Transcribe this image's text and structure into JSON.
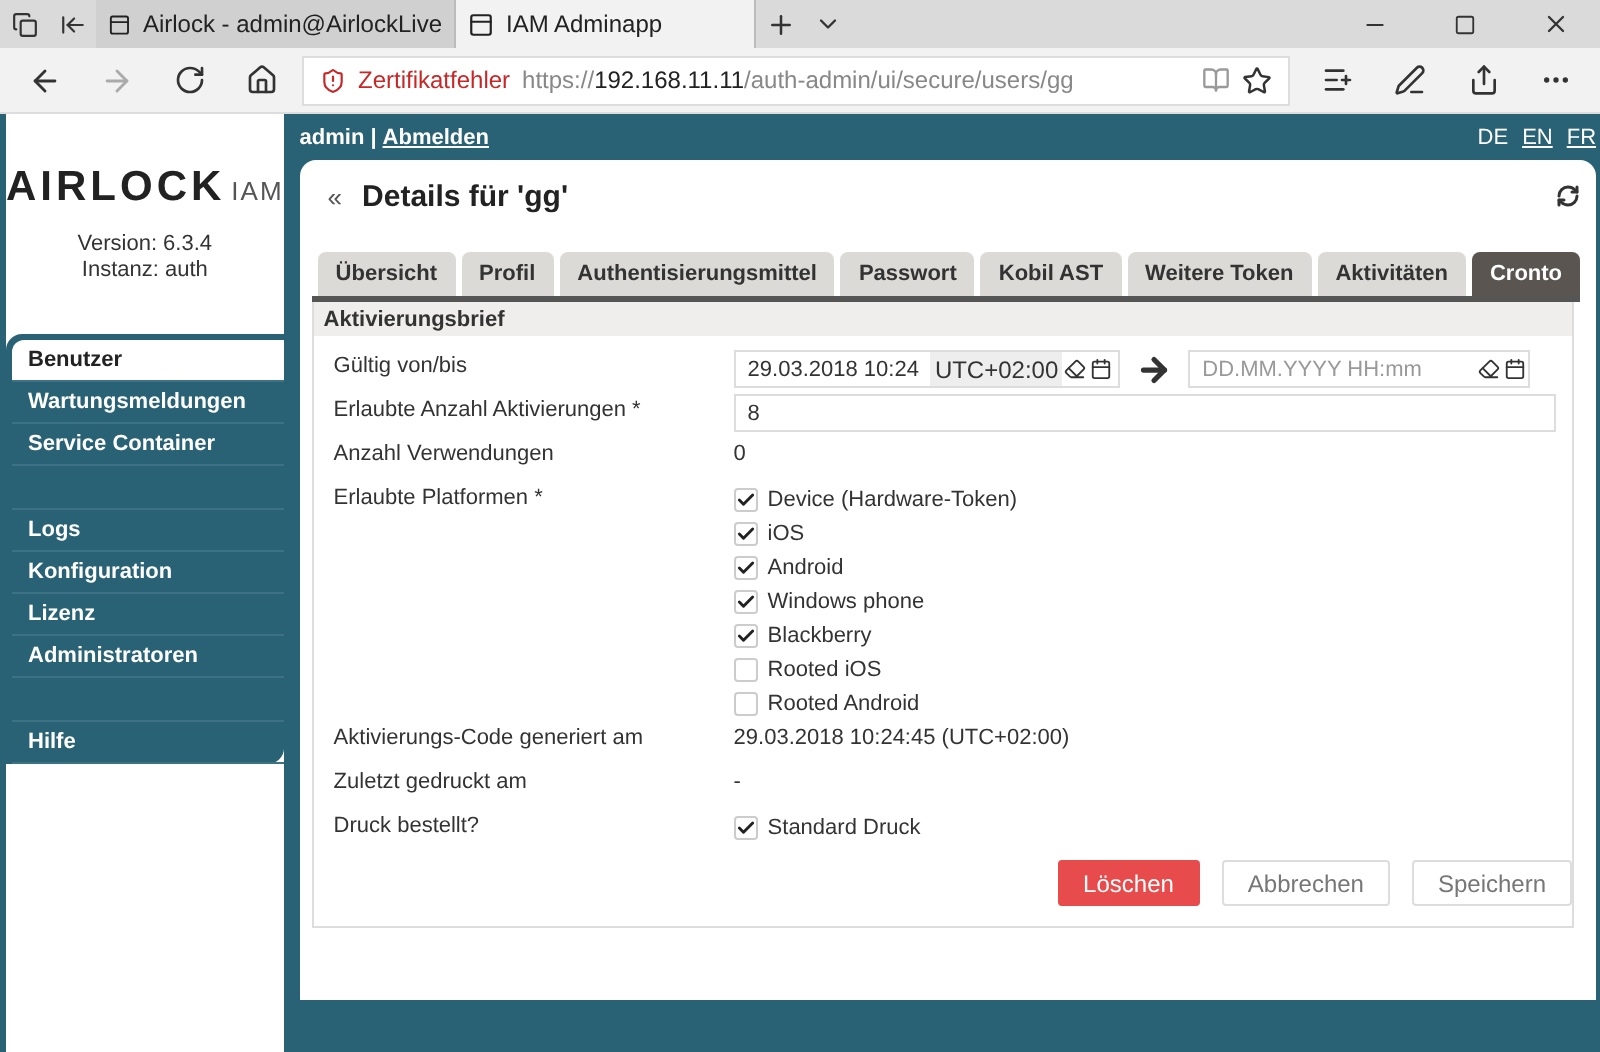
{
  "browser": {
    "tabs": [
      {
        "title": "Airlock - admin@AirlockLive",
        "selected": false
      },
      {
        "title": "IAM Adminapp",
        "selected": true
      }
    ],
    "address": {
      "warning": "Zertifikatfehler",
      "url_prefix": "https://",
      "host": "192.168.11.11",
      "path": "/auth-admin/ui/secure/users/gg"
    }
  },
  "header": {
    "user": "admin",
    "separator": "|",
    "logout": "Abmelden",
    "languages": [
      {
        "code": "DE",
        "selected": true
      },
      {
        "code": "EN",
        "selected": false
      },
      {
        "code": "FR",
        "selected": false
      }
    ]
  },
  "sidebar": {
    "logo_main": "AIRLOCK",
    "logo_sub": "IAM",
    "version": "Version: 6.3.4",
    "instance": "Instanz: auth",
    "items": [
      {
        "label": "Benutzer",
        "selected": true
      },
      {
        "label": "Wartungsmeldungen",
        "selected": false
      },
      {
        "label": "Service Container",
        "selected": false
      },
      {
        "label": "Logs",
        "selected": false,
        "gap_before": true
      },
      {
        "label": "Konfiguration",
        "selected": false
      },
      {
        "label": "Lizenz",
        "selected": false
      },
      {
        "label": "Administratoren",
        "selected": false
      },
      {
        "label": "Hilfe",
        "selected": false,
        "gap_before": true
      }
    ]
  },
  "page": {
    "back": "«",
    "title": "Details für 'gg'",
    "tabs": [
      {
        "label": "Übersicht",
        "selected": false
      },
      {
        "label": "Profil",
        "selected": false
      },
      {
        "label": "Authentisierungsmittel",
        "selected": false
      },
      {
        "label": "Passwort",
        "selected": false
      },
      {
        "label": "Kobil AST",
        "selected": false
      },
      {
        "label": "Weitere Token",
        "selected": false
      },
      {
        "label": "Aktivitäten",
        "selected": false
      },
      {
        "label": "Cronto",
        "selected": true
      }
    ],
    "section": "Aktivierungsbrief",
    "rows": [
      {
        "kind": "daterange",
        "label": "Gültig von/bis",
        "from": "29.03.2018 10:24",
        "timezone": "UTC+02:00",
        "to_placeholder": "DD.MM.YYYY HH:mm"
      },
      {
        "kind": "input",
        "label": "Erlaubte Anzahl Aktivierungen *",
        "value": "8"
      },
      {
        "kind": "text",
        "label": "Anzahl Verwendungen",
        "value": "0"
      },
      {
        "kind": "checks",
        "label": "Erlaubte Platformen *",
        "options": [
          {
            "label": "Device (Hardware-Token)",
            "checked": true
          },
          {
            "label": "iOS",
            "checked": true
          },
          {
            "label": "Android",
            "checked": true
          },
          {
            "label": "Windows phone",
            "checked": true
          },
          {
            "label": "Blackberry",
            "checked": true
          },
          {
            "label": "Rooted iOS",
            "checked": false
          },
          {
            "label": "Rooted Android",
            "checked": false
          }
        ]
      },
      {
        "kind": "text",
        "label": "Aktivierungs-Code generiert am",
        "value": "29.03.2018 10:24:45 (UTC+02:00)"
      },
      {
        "kind": "text",
        "label": "Zuletzt gedruckt am",
        "value": "-"
      },
      {
        "kind": "checks",
        "label": "Druck bestellt?",
        "options": [
          {
            "label": "Standard Druck",
            "checked": true
          }
        ]
      }
    ],
    "buttons": [
      {
        "label": "Löschen",
        "kind": "danger"
      },
      {
        "label": "Abbrechen",
        "kind": "default"
      },
      {
        "label": "Speichern",
        "kind": "default"
      }
    ]
  }
}
